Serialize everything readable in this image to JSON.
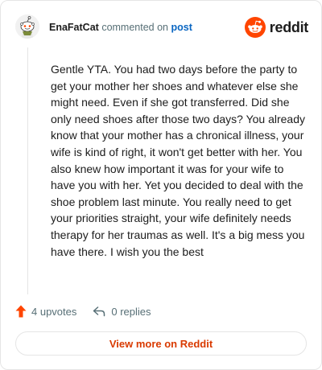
{
  "comment": {
    "author": "EnaFatCat",
    "action_text": "commented on",
    "post_link": "post",
    "body": "Gentle YTA. You had two days before the party to get your mother her shoes and whatever else she might need. Even if she got transferred. Did she only need shoes after those two days? You already know that your mother has a chronical illness, your wife is kind of right, it won't get better with her. You also knew how important it was for your wife to have you with her. Yet you decided to deal with the shoe problem last minute. You really need to get your priorities straight, your wife definitely needs therapy for her traumas as well. It's a big mess you have there. I wish you the best",
    "upvotes": "4 upvotes",
    "replies": "0 replies"
  },
  "brand": {
    "wordmark": "reddit",
    "accent": "#ff4500"
  },
  "cta": {
    "label": "View more on Reddit"
  },
  "icons": {
    "avatar": "snoo-avatar",
    "logo": "reddit-logo-icon",
    "upvote": "upvote-arrow-icon",
    "reply": "reply-arrow-icon"
  },
  "colors": {
    "upvote": "#ff4500",
    "link": "#0a66c2",
    "cta_text": "#d93a00",
    "meta": "#576f76"
  }
}
